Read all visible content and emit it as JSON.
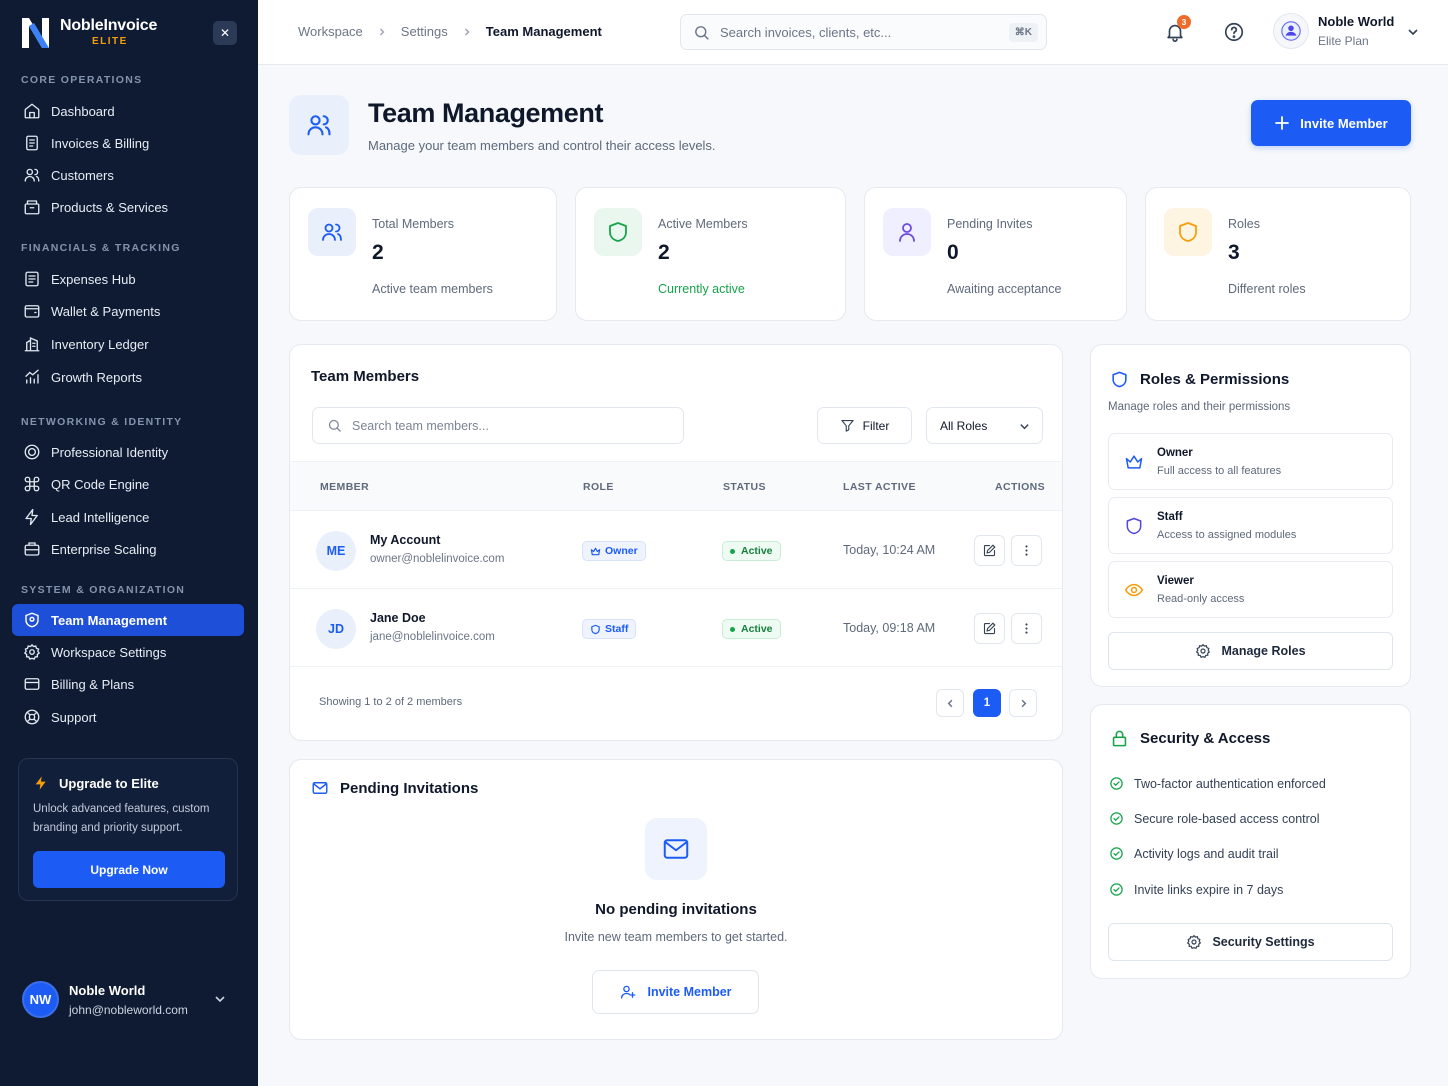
{
  "brand": {
    "name": "NobleInvoice",
    "tier": "ELITE"
  },
  "sidebar": {
    "sections": [
      {
        "title": "CORE OPERATIONS"
      },
      {
        "title": "FINANCIALS & TRACKING"
      },
      {
        "title": "NETWORKING & IDENTITY"
      },
      {
        "title": "SYSTEM & ORGANIZATION"
      }
    ],
    "items": [
      {
        "label": "Dashboard",
        "icon": "home-icon"
      },
      {
        "label": "Invoices & Billing",
        "icon": "file-icon"
      },
      {
        "label": "Customers",
        "icon": "users-icon"
      },
      {
        "label": "Products & Services",
        "icon": "box-icon"
      },
      {
        "label": "Expenses Hub",
        "icon": "receipt-icon"
      },
      {
        "label": "Wallet & Payments",
        "icon": "wallet-icon"
      },
      {
        "label": "Inventory Ledger",
        "icon": "building-icon"
      },
      {
        "label": "Growth Reports",
        "icon": "chart-icon"
      },
      {
        "label": "Professional Identity",
        "icon": "badge-icon"
      },
      {
        "label": "QR Code Engine",
        "icon": "command-icon"
      },
      {
        "label": "Lead Intelligence",
        "icon": "bolt-icon"
      },
      {
        "label": "Enterprise Scaling",
        "icon": "briefcase-icon"
      },
      {
        "label": "Team Management",
        "icon": "shield-user-icon",
        "active": true
      },
      {
        "label": "Workspace Settings",
        "icon": "gear-icon"
      },
      {
        "label": "Billing & Plans",
        "icon": "card-icon"
      },
      {
        "label": "Support",
        "icon": "lifebuoy-icon"
      }
    ],
    "upgrade": {
      "title": "Upgrade to Elite",
      "description": "Unlock advanced features, custom branding and priority support.",
      "button": "Upgrade Now"
    },
    "user": {
      "initials": "NW",
      "name": "Noble World",
      "email": "john@nobleworld.com"
    }
  },
  "topbar": {
    "breadcrumbs": [
      "Workspace",
      "Settings",
      "Team Management"
    ],
    "search_placeholder": "Search invoices, clients, etc...",
    "search_shortcut": "⌘K",
    "notification_count": "3",
    "profile": {
      "name": "Noble World",
      "plan": "Elite Plan"
    }
  },
  "header": {
    "title": "Team Management",
    "subtitle": "Manage your team members and control their access levels.",
    "invite_label": "Invite Member"
  },
  "stats": [
    {
      "label": "Total Members",
      "value": "2",
      "note": "Active team members"
    },
    {
      "label": "Active Members",
      "value": "2",
      "note": "Currently active"
    },
    {
      "label": "Pending Invites",
      "value": "0",
      "note": "Awaiting acceptance"
    },
    {
      "label": "Roles",
      "value": "3",
      "note": "Different roles"
    }
  ],
  "team": {
    "title": "Team Members",
    "search_placeholder": "Search team members...",
    "filter_label": "Filter",
    "roles_filter": "All Roles",
    "columns": [
      "MEMBER",
      "ROLE",
      "STATUS",
      "LAST ACTIVE",
      "ACTIONS"
    ],
    "rows": [
      {
        "initials": "ME",
        "name": "My Account",
        "email": "owner@noblelinvoice.com",
        "role": "Owner",
        "status": "Active",
        "last_active": "Today, 10:24 AM"
      },
      {
        "initials": "JD",
        "name": "Jane Doe",
        "email": "jane@noblelinvoice.com",
        "role": "Staff",
        "status": "Active",
        "last_active": "Today, 09:18 AM"
      }
    ],
    "showing": "Showing 1 to 2 of 2 members",
    "current_page": "1"
  },
  "pending": {
    "title": "Pending Invitations",
    "empty_title": "No pending invitations",
    "empty_sub": "Invite new team members to get started.",
    "button": "Invite Member"
  },
  "roles_panel": {
    "title": "Roles & Permissions",
    "subtitle": "Manage roles and their permissions",
    "roles": [
      {
        "name": "Owner",
        "desc": "Full access to all features",
        "icon": "crown-icon"
      },
      {
        "name": "Staff",
        "desc": "Access to assigned modules",
        "icon": "shield-icon"
      },
      {
        "name": "Viewer",
        "desc": "Read-only access",
        "icon": "eye-icon"
      }
    ],
    "button": "Manage Roles"
  },
  "security": {
    "title": "Security & Access",
    "items": [
      "Two-factor authentication enforced",
      "Secure role-based access control",
      "Activity logs and audit trail",
      "Invite links expire in 7 days"
    ],
    "button": "Security Settings"
  },
  "colors": {
    "primary": "#1c5cf5",
    "sidebar": "#0f1b33",
    "success": "#16a34a",
    "warning": "#f59e0b"
  }
}
